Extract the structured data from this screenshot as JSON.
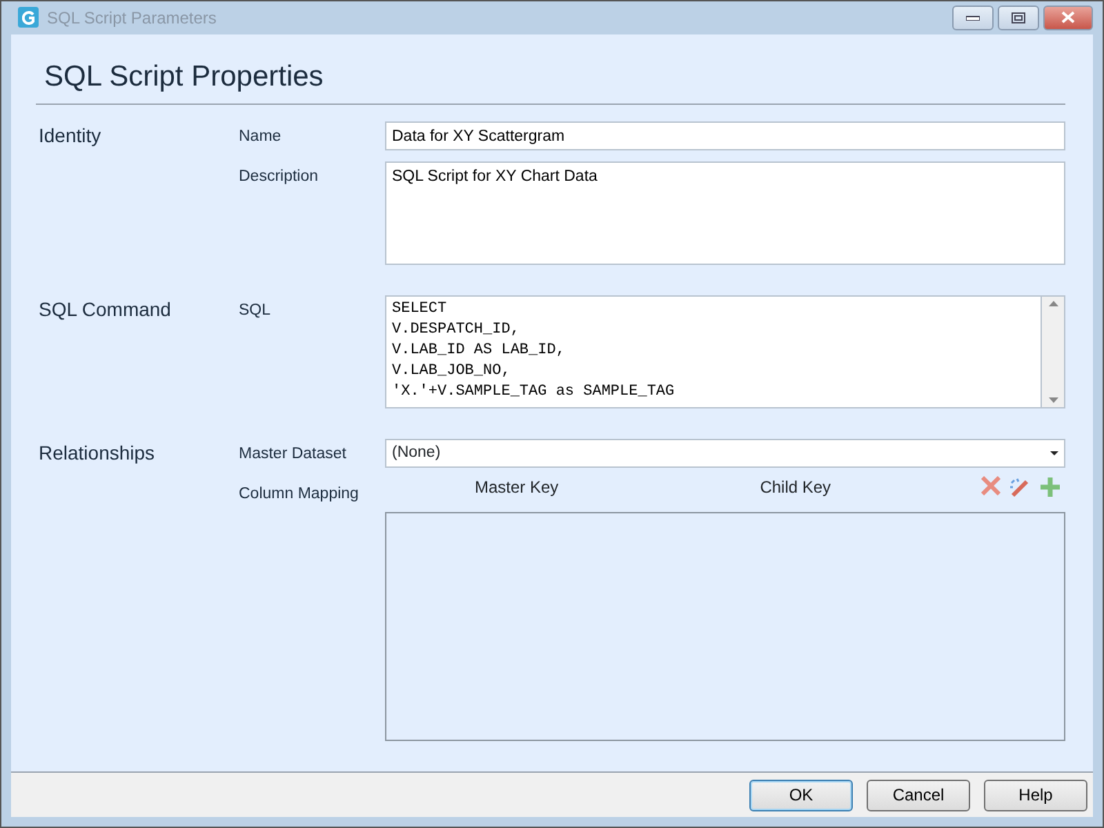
{
  "window": {
    "title": "SQL Script Parameters"
  },
  "heading": "SQL Script Properties",
  "sections": [
    {
      "title": "Identity",
      "fields": [
        {
          "kind": "text",
          "label": "Name",
          "value": "Data for XY Scattergram"
        },
        {
          "kind": "memo",
          "label": "Description",
          "value": "SQL Script for XY Chart Data"
        }
      ]
    },
    {
      "title": "SQL Command",
      "fields": [
        {
          "kind": "code",
          "label": "SQL",
          "lines": [
            "SELECT",
            "V.DESPATCH_ID,",
            "V.LAB_ID AS LAB_ID,",
            "V.LAB_JOB_NO,",
            "'X.'+V.SAMPLE_TAG as SAMPLE_TAG"
          ]
        }
      ]
    },
    {
      "title": "Relationships",
      "fields": [
        {
          "kind": "dropdown",
          "label": "Master Dataset",
          "value": "(None)"
        },
        {
          "kind": "mapping",
          "label": "Column Mapping",
          "columns": [
            "Master Key",
            "Child Key"
          ]
        }
      ]
    }
  ],
  "buttons": [
    {
      "label": "OK",
      "default": true
    },
    {
      "label": "Cancel",
      "default": false
    },
    {
      "label": "Help",
      "default": false
    }
  ]
}
